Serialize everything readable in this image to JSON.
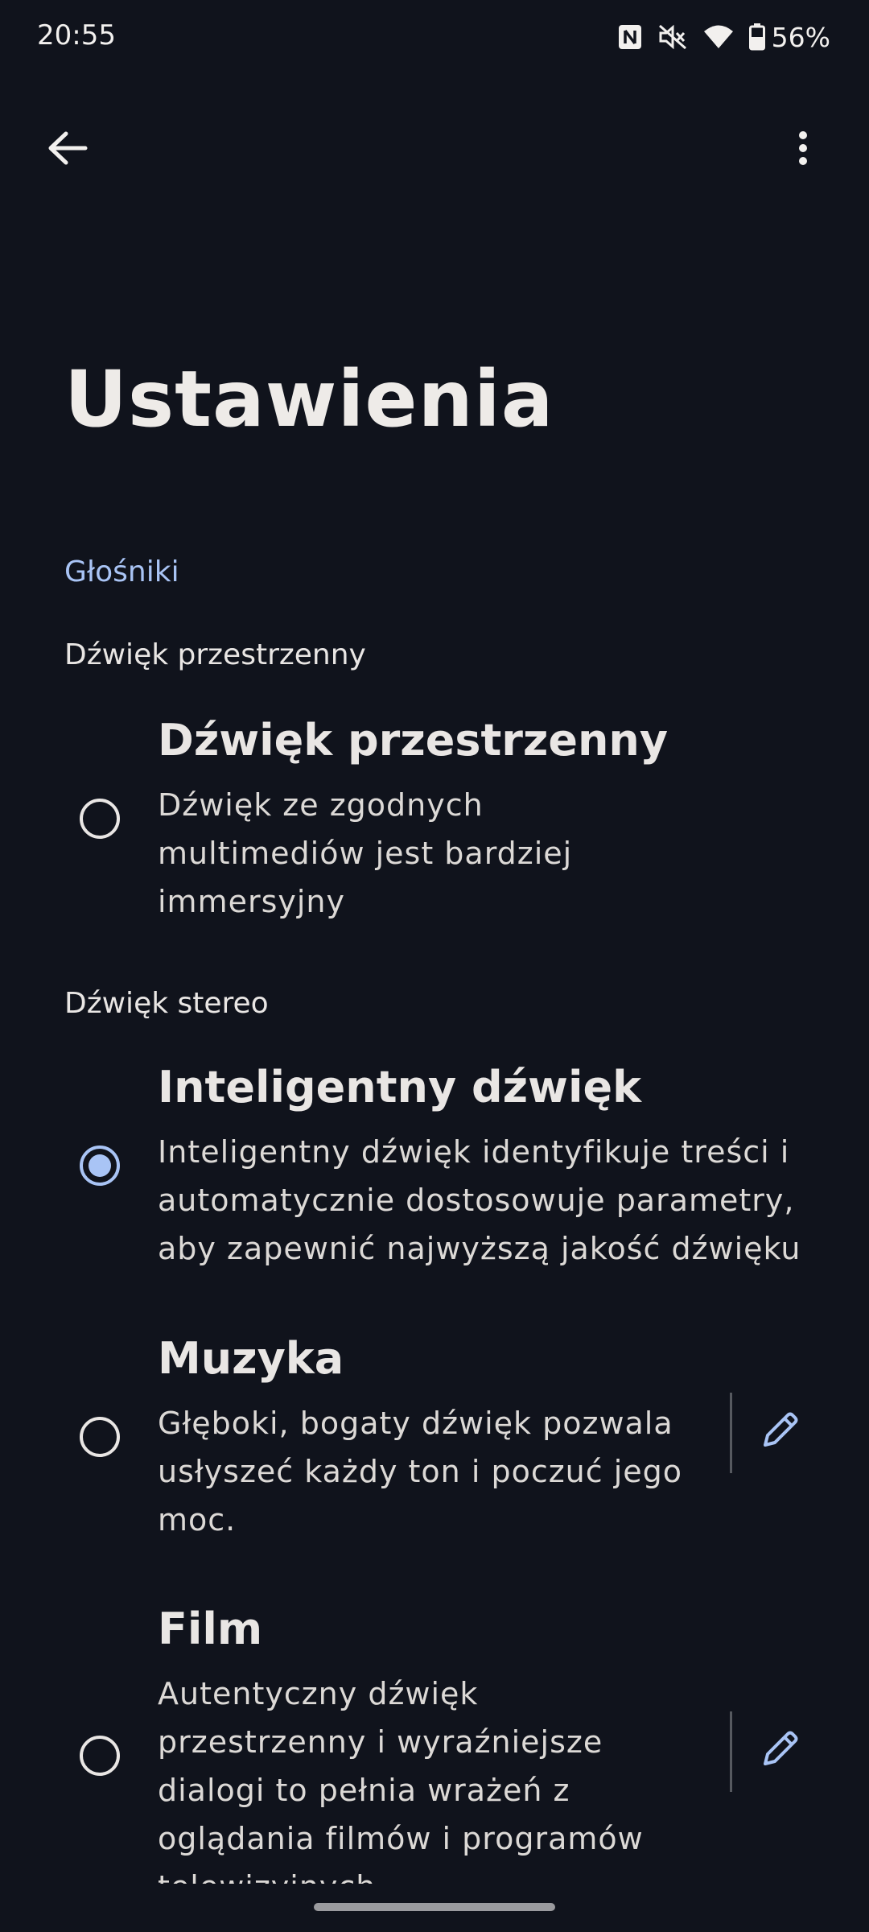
{
  "status_bar": {
    "time": "20:55",
    "battery": "56%",
    "icons": [
      "nfc-icon",
      "mute-icon",
      "wifi-icon",
      "battery-icon"
    ]
  },
  "app_bar": {
    "back_icon": "back-arrow-icon",
    "menu_icon": "more-vert-icon"
  },
  "page": {
    "title": "Ustawienia"
  },
  "section": {
    "header": "Głośniki"
  },
  "groups": [
    {
      "label": "Dźwięk przestrzenny",
      "options": [
        {
          "title": "Dźwięk przestrzenny",
          "description_lines": [
            "Dźwięk ze zgodnych",
            "multimediów jest bardziej",
            "immersyjny"
          ],
          "selected": false
        }
      ]
    },
    {
      "label": "Dźwięk stereo",
      "options": [
        {
          "title": "Inteligentny dźwięk",
          "description_lines": [
            "Inteligentny dźwięk identyfikuje treści i",
            "automatycznie dostosowuje parametry,",
            "aby zapewnić najwyższą jakość dźwięku"
          ],
          "selected": true
        },
        {
          "title": "Muzyka",
          "description_lines": [
            "Głęboki, bogaty dźwięk pozwala",
            "usłyszeć każdy ton i poczuć jego",
            "moc."
          ],
          "selected": false,
          "edit_icon": "pencil-icon"
        },
        {
          "title": "Film",
          "description_lines": [
            "Autentyczny dźwięk",
            "przestrzenny i wyraźniejsze",
            "dialogi to pełnia wrażeń z",
            "oglądania filmów i programów",
            "telewizyjnych"
          ],
          "selected": false,
          "edit_icon": "pencil-icon"
        }
      ]
    }
  ],
  "colors": {
    "background": "#10131c",
    "accent": "#a9c4f5",
    "text": "#e9e6e4"
  }
}
